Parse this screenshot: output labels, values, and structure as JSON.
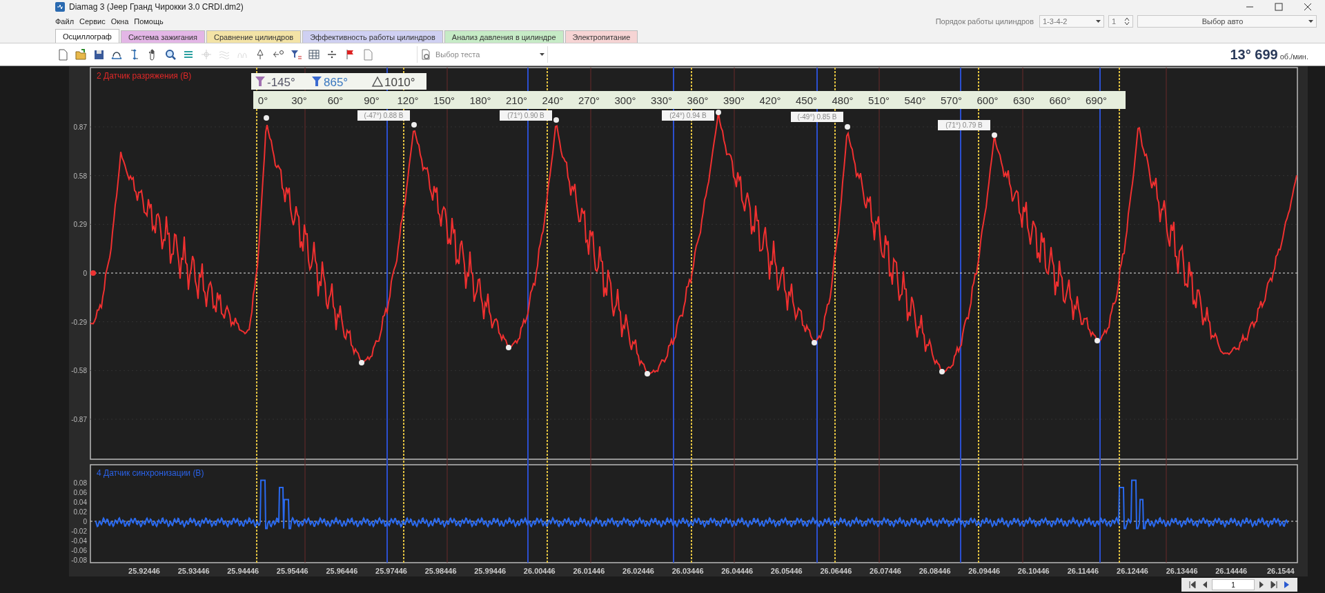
{
  "window": {
    "title": "Diamag 3 (Jeep Гранд Чирокки 3.0 CRDI.dm2)"
  },
  "menu": [
    "Файл",
    "Сервис",
    "Окна",
    "Помощь"
  ],
  "tabs": [
    {
      "label": "Осциллограф",
      "selected": true,
      "color": "#ffffff"
    },
    {
      "label": "Система зажигания",
      "selected": false,
      "color": "#e3b6e6"
    },
    {
      "label": "Сравнение цилиндров",
      "selected": false,
      "color": "#f3e3a6"
    },
    {
      "label": "Эффективность работы цилиндров",
      "selected": false,
      "color": "#cfd0f2"
    },
    {
      "label": "Анализ давления в цилиндре",
      "selected": false,
      "color": "#c6ebc6"
    },
    {
      "label": "Электропитание",
      "selected": false,
      "color": "#f6d4d4"
    }
  ],
  "toolbar": {
    "buttons": [
      {
        "kind": "new",
        "disabled": false
      },
      {
        "kind": "open",
        "disabled": false
      },
      {
        "kind": "save",
        "disabled": false
      },
      {
        "kind": "fit-horizontal",
        "disabled": false
      },
      {
        "kind": "fit-vertical",
        "disabled": false
      },
      {
        "kind": "pan",
        "disabled": false
      },
      {
        "kind": "zoom",
        "disabled": false
      },
      {
        "kind": "layers",
        "disabled": false
      },
      {
        "kind": "snap",
        "disabled": true
      },
      {
        "kind": "overlay",
        "disabled": true
      },
      {
        "kind": "scope",
        "disabled": true
      },
      {
        "kind": "auto",
        "disabled": false
      },
      {
        "kind": "zero",
        "disabled": false
      },
      {
        "kind": "filter",
        "disabled": false
      },
      {
        "kind": "table",
        "disabled": false
      },
      {
        "kind": "divide",
        "disabled": false
      },
      {
        "kind": "flag",
        "disabled": false
      },
      {
        "kind": "page",
        "disabled": false
      }
    ],
    "test_select": {
      "value": "Выбор теста"
    }
  },
  "cylinder_order": {
    "label": "Порядок работы цилиндров",
    "value": "1-3-4-2",
    "cylinder": "1"
  },
  "vehicle_select": {
    "value": "Выбор авто"
  },
  "rpm": {
    "value": "13° 699",
    "unit": "об./мин."
  },
  "upper_channel": {
    "title": "2 Датчик разряжения (В)",
    "y_ticks": [
      "0.87",
      "0.58",
      "0.29",
      "0",
      "-0.29",
      "-0.58",
      "-0.87"
    ]
  },
  "cursors": {
    "left": "-145°",
    "right": "865°",
    "delta": "1010°"
  },
  "degree_scale": [
    "0°",
    "30°",
    "60°",
    "90°",
    "120°",
    "150°",
    "180°",
    "210°",
    "240°",
    "270°",
    "300°",
    "330°",
    "360°",
    "390°",
    "420°",
    "450°",
    "480°",
    "510°",
    "540°",
    "570°",
    "600°",
    "630°",
    "660°",
    "690°"
  ],
  "markers": [
    {
      "label": "(-47°) 0.88 В"
    },
    {
      "label": "(71°) 0.90 В"
    },
    {
      "label": "(24°) 0.94 В"
    },
    {
      "label": "(-49°) 0.85 В"
    },
    {
      "label": "(71°) 0.79 В"
    }
  ],
  "lower_channel": {
    "title": "4 Датчик синхронизации (В)",
    "y_ticks": [
      "0.08",
      "0.06",
      "0.04",
      "0.02",
      "0",
      "-0.02",
      "-0.04",
      "-0.06",
      "-0.08"
    ]
  },
  "time_axis": [
    "25.92446",
    "25.93446",
    "25.94446",
    "25.95446",
    "25.96446",
    "25.97446",
    "25.98446",
    "25.99446",
    "26.00446",
    "26.01446",
    "26.02446",
    "26.03446",
    "26.04446",
    "26.05446",
    "26.06446",
    "26.07446",
    "26.08446",
    "26.09446",
    "26.10446",
    "26.11446",
    "26.12446",
    "26.13446",
    "26.14446",
    "26.1544"
  ],
  "pager": {
    "value": "1"
  }
}
